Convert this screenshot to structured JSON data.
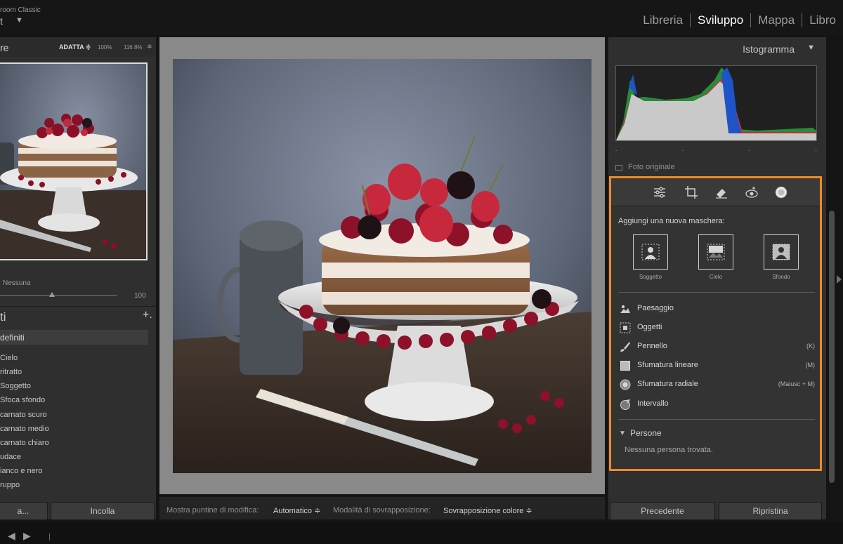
{
  "app": {
    "name": "room Classic",
    "catalog": "t"
  },
  "modules": [
    {
      "label": "Libreria",
      "active": false
    },
    {
      "label": "Sviluppo",
      "active": true
    },
    {
      "label": "Mappa",
      "active": false
    },
    {
      "label": "Libro",
      "active": false
    }
  ],
  "navigator": {
    "title": "re",
    "zoom_fit": "ADATTA ≑",
    "zoom_100": "100%",
    "zoom_116": "116.8%",
    "label": "Nessuna",
    "value": "100"
  },
  "presets": {
    "title": "ti",
    "add_icon": "+.",
    "selected_group": "definiti",
    "items": [
      "Cielo",
      "ritratto",
      "Soggetto",
      "Sfoca sfondo",
      "carnato scuro",
      "carnato medio",
      "carnato chiaro",
      "udace",
      "ianco e nero",
      "ruppo"
    ]
  },
  "left_buttons": {
    "copy": "a...",
    "paste": "Incolla"
  },
  "toolbar": {
    "pins_label": "Mostra puntine di modifica:",
    "pins_value": "Automatico ≑",
    "overlay_label": "Modalità di sovrapposizione:",
    "overlay_value": "Sovrapposizione colore ≑"
  },
  "histogram": {
    "title": "Istogramma",
    "ticks": [
      "-",
      "-",
      "-",
      "-"
    ],
    "original_photo_label": "Foto originale"
  },
  "masking": {
    "tools": [
      "sliders-icon",
      "crop-icon",
      "eraser-icon",
      "redeye-icon",
      "mask-icon"
    ],
    "add_label": "Aggiungi una nuova maschera:",
    "tiles": [
      {
        "label": "Soggetto",
        "icon": "subject-icon"
      },
      {
        "label": "Cielo",
        "icon": "sky-icon"
      },
      {
        "label": "Sfondo",
        "icon": "background-icon"
      }
    ],
    "rows": [
      {
        "label": "Paesaggio",
        "key": ""
      },
      {
        "label": "Oggetti",
        "key": ""
      },
      {
        "label": "Pennello",
        "key": "(K)"
      },
      {
        "label": "Sfumatura lineare",
        "key": "(M)"
      },
      {
        "label": "Sfumatura radiale",
        "key": "(Maiusc + M)"
      },
      {
        "label": "Intervallo",
        "key": ""
      }
    ],
    "people_title": "Persone",
    "people_empty": "Nessuna persona trovata."
  },
  "right_buttons": {
    "previous": "Precedente",
    "reset": "Ripristina"
  },
  "colors": {
    "highlight": "#f08a25",
    "panel": "#2f2f2f",
    "background": "#141414"
  }
}
